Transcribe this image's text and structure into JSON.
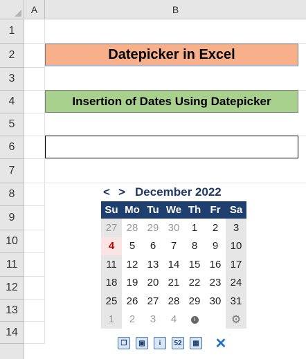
{
  "columns": [
    "A",
    "B"
  ],
  "rows": [
    "1",
    "2",
    "3",
    "4",
    "5",
    "6",
    "7",
    "8",
    "9",
    "10",
    "11",
    "12",
    "13",
    "14"
  ],
  "title": "Datepicker in Excel",
  "subtitle": "Insertion of Dates Using Datepicker",
  "datepicker": {
    "prev": "<",
    "next": ">",
    "month_label": "December 2022",
    "weekdays": [
      "Su",
      "Mo",
      "Tu",
      "We",
      "Th",
      "Fr",
      "Sa"
    ],
    "weeks": [
      [
        "27",
        "28",
        "29",
        "30",
        "1",
        "2",
        "3"
      ],
      [
        "4",
        "5",
        "6",
        "7",
        "8",
        "9",
        "10"
      ],
      [
        "11",
        "12",
        "13",
        "14",
        "15",
        "16",
        "17"
      ],
      [
        "18",
        "19",
        "20",
        "21",
        "22",
        "23",
        "24"
      ],
      [
        "25",
        "26",
        "27",
        "28",
        "29",
        "30",
        "31"
      ],
      [
        "1",
        "2",
        "3",
        "4",
        "",
        "",
        ""
      ]
    ],
    "today": "4",
    "colors": {
      "header": "#1f3f6e",
      "today": "#cc0000",
      "weekend_bg": "#e6e6e6"
    },
    "toolbar_icons": [
      "restore-icon",
      "window-icon",
      "info-icon",
      "week-number-icon",
      "calendar-icon",
      "close-icon"
    ],
    "toolbar_week_label": "52"
  }
}
